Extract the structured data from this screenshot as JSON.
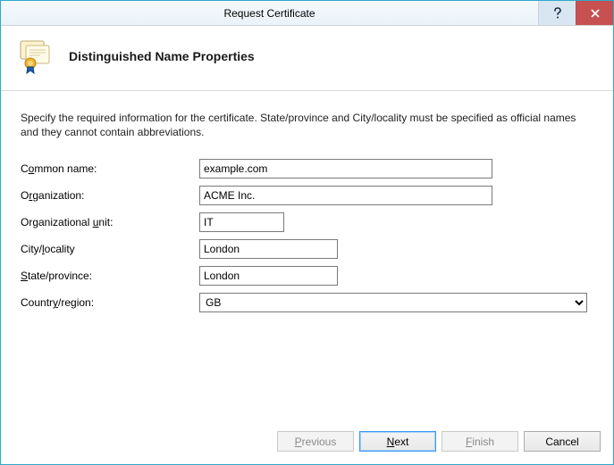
{
  "window": {
    "title": "Request Certificate"
  },
  "header": {
    "title": "Distinguished Name Properties"
  },
  "intro": "Specify the required information for the certificate. State/province and City/locality must be specified as official names and they cannot contain abbreviations.",
  "fields": {
    "common_name": {
      "label_pre": "C",
      "label_ul": "o",
      "label_post": "mmon name:",
      "value": "example.com"
    },
    "organization": {
      "label_pre": "O",
      "label_ul": "r",
      "label_post": "ganization:",
      "value": "ACME Inc."
    },
    "organizational_unit": {
      "label_pre": "Organizational ",
      "label_ul": "u",
      "label_post": "nit:",
      "value": "IT"
    },
    "city": {
      "label_pre": "City/",
      "label_ul": "l",
      "label_post": "ocality",
      "value": "London"
    },
    "state": {
      "label_pre": "",
      "label_ul": "S",
      "label_post": "tate/province:",
      "value": "London"
    },
    "country": {
      "label_pre": "Countr",
      "label_ul": "y",
      "label_post": "/region:",
      "value": "GB"
    }
  },
  "buttons": {
    "previous": {
      "pre": "",
      "ul": "P",
      "post": "revious"
    },
    "next": {
      "pre": "",
      "ul": "N",
      "post": "ext"
    },
    "finish": {
      "pre": "",
      "ul": "F",
      "post": "inish"
    },
    "cancel": {
      "label": "Cancel"
    }
  }
}
